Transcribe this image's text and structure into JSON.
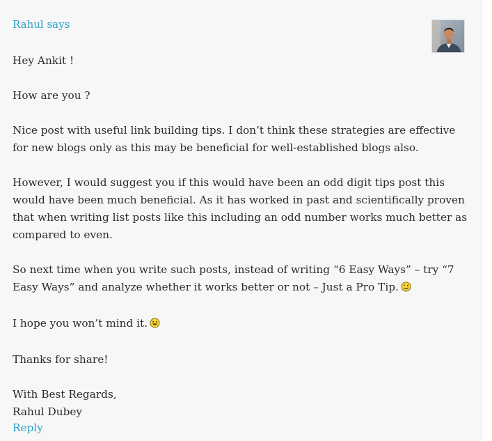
{
  "comment": {
    "author_label": "Rahul says",
    "paragraphs": {
      "greeting": "Hey Ankit !",
      "question": "How are you ?",
      "p1": "Nice post with useful link building tips. I don’t think these strategies are effective for new blogs only as this may be beneficial for well-established blogs also.",
      "p2": "However, I would suggest you if this would have been an odd digit tips post this would have been much beneficial. As it has worked in past and scientifically proven that when writing list posts like this including an odd number works much better as compared to even.",
      "p3": "So next time when you write such posts, instead of writing “6 Easy Ways” – try “7 Easy Ways” and analyze whether it works better or not – Just a Pro Tip.",
      "p4": "I hope you won’t mind it.",
      "p5": "Thanks for share!",
      "sign_line1": "With Best Regards,",
      "sign_line2": "Rahul Dubey"
    },
    "reply_label": "Reply",
    "icons": {
      "wink": "wink-smiley-icon",
      "smile": "smile-smiley-icon"
    },
    "colors": {
      "link": "#2aa0c4",
      "text": "#2a2a2a",
      "background": "#f7f7f7"
    }
  }
}
